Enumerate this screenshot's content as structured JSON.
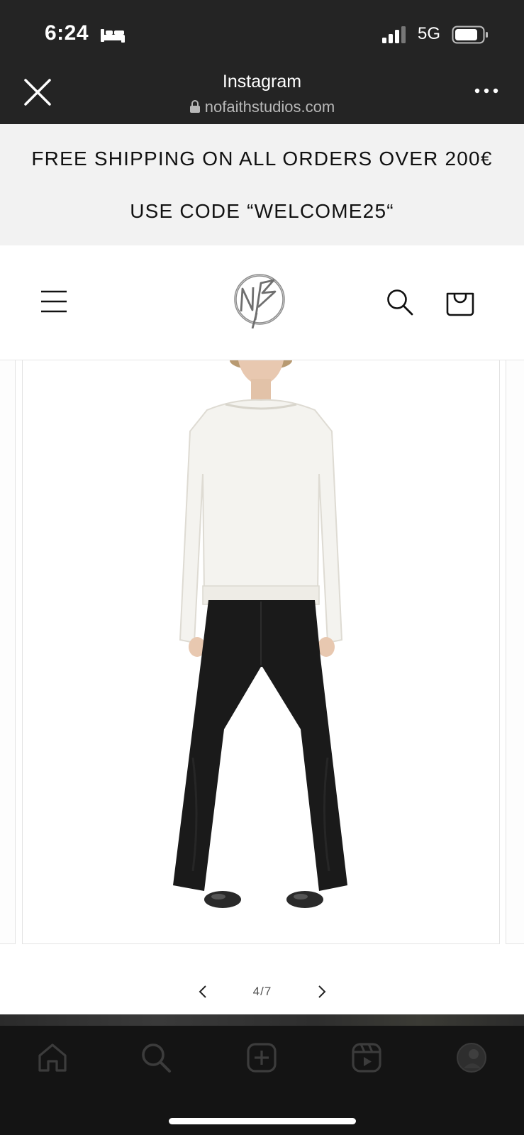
{
  "status_bar": {
    "time": "6:24",
    "network": "5G",
    "icons": [
      "bed-icon",
      "signal-icon",
      "battery-icon"
    ]
  },
  "browser": {
    "title": "Instagram",
    "url": "nofaithstudios.com",
    "icons": [
      "close-icon",
      "lock-icon",
      "more-icon"
    ]
  },
  "announcement": {
    "line1": "FREE SHIPPING ON ALL ORDERS OVER 200€",
    "line2": "USE CODE “WELCOME25“"
  },
  "store_header": {
    "icons": [
      "menu-icon",
      "brand-logo",
      "search-icon",
      "cart-icon"
    ],
    "logo_monogram": "NF"
  },
  "gallery": {
    "counter": "4/7",
    "current": 4,
    "total": 7,
    "icons": [
      "chevron-left-icon",
      "chevron-right-icon"
    ]
  },
  "bottom_nav": {
    "icons": [
      "home-icon",
      "search-icon",
      "create-icon",
      "reels-icon",
      "profile-avatar"
    ]
  },
  "colors": {
    "chrome_dark": "#242424",
    "banner_bg": "#f2f2f2",
    "text_dark": "#111111",
    "nav_bg": "#141414"
  }
}
